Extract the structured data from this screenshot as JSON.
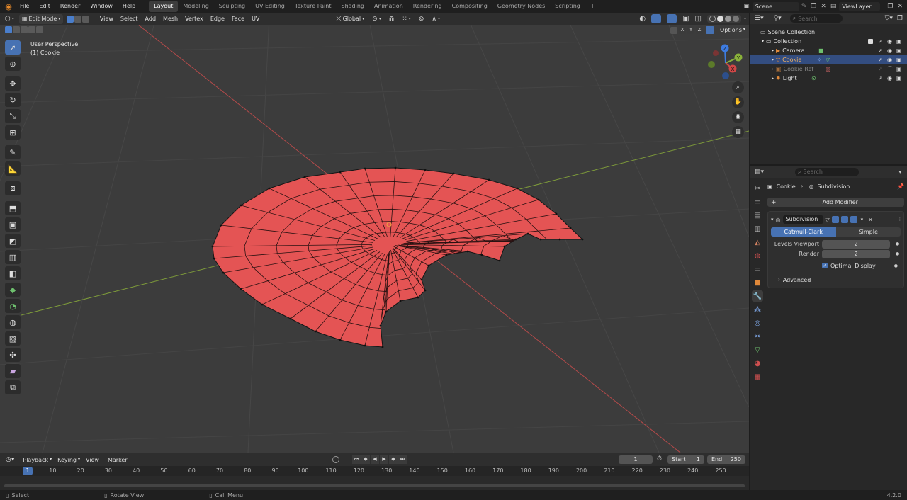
{
  "topbar": {
    "menus": [
      "File",
      "Edit",
      "Render",
      "Window",
      "Help"
    ],
    "workspaces": [
      "Layout",
      "Modeling",
      "Sculpting",
      "UV Editing",
      "Texture Paint",
      "Shading",
      "Animation",
      "Rendering",
      "Compositing",
      "Geometry Nodes",
      "Scripting"
    ],
    "add_tab": "+",
    "scene_label": "Scene",
    "viewlayer_label": "ViewLayer"
  },
  "viewport_header": {
    "mode": "Edit Mode",
    "menus": [
      "View",
      "Select",
      "Add",
      "Mesh",
      "Vertex",
      "Edge",
      "Face",
      "UV"
    ],
    "transform_orientation": "Global",
    "axes": [
      "X",
      "Y",
      "Z"
    ],
    "options": "Options"
  },
  "viewport": {
    "perspective_label": "User Perspective",
    "object_label": "(1) Cookie",
    "gizmo_axes": [
      "X",
      "Y",
      "Z"
    ],
    "colors": {
      "mesh": "#e45454",
      "background": "#3c3c3c",
      "x_axis": "#b44a4a",
      "y_axis": "#7d9a3a"
    }
  },
  "outliner": {
    "search_placeholder": "Search",
    "root": "Scene Collection",
    "collection": "Collection",
    "items": [
      {
        "name": "Camera",
        "selected": false
      },
      {
        "name": "Cookie",
        "selected": true
      },
      {
        "name": "Cookie Ref",
        "selected": false
      },
      {
        "name": "Light",
        "selected": false
      }
    ]
  },
  "properties": {
    "search_placeholder": "Search",
    "breadcrumb_object": "Cookie",
    "breadcrumb_modifier": "Subdivision",
    "add_modifier": "Add Modifier",
    "modifier_name": "Subdivision",
    "mode_options": [
      "Catmull-Clark",
      "Simple"
    ],
    "active_mode": "Catmull-Clark",
    "levels_viewport_label": "Levels Viewport",
    "levels_viewport_value": "2",
    "render_label": "Render",
    "render_value": "2",
    "optimal_display_label": "Optimal Display",
    "optimal_display_checked": true,
    "advanced_label": "Advanced"
  },
  "timeline": {
    "menus": [
      "Playback",
      "Keying",
      "View",
      "Marker"
    ],
    "current_frame": "1",
    "start_label": "Start",
    "start_value": "1",
    "end_label": "End",
    "end_value": "250",
    "ruler_ticks": [
      "1",
      "10",
      "20",
      "30",
      "40",
      "50",
      "60",
      "70",
      "80",
      "90",
      "100",
      "110",
      "120",
      "130",
      "140",
      "150",
      "160",
      "170",
      "180",
      "190",
      "200",
      "210",
      "220",
      "230",
      "240",
      "250"
    ]
  },
  "statusbar": {
    "select": "Select",
    "rotate_view": "Rotate View",
    "call_menu": "Call Menu",
    "version": "4.2.0"
  }
}
